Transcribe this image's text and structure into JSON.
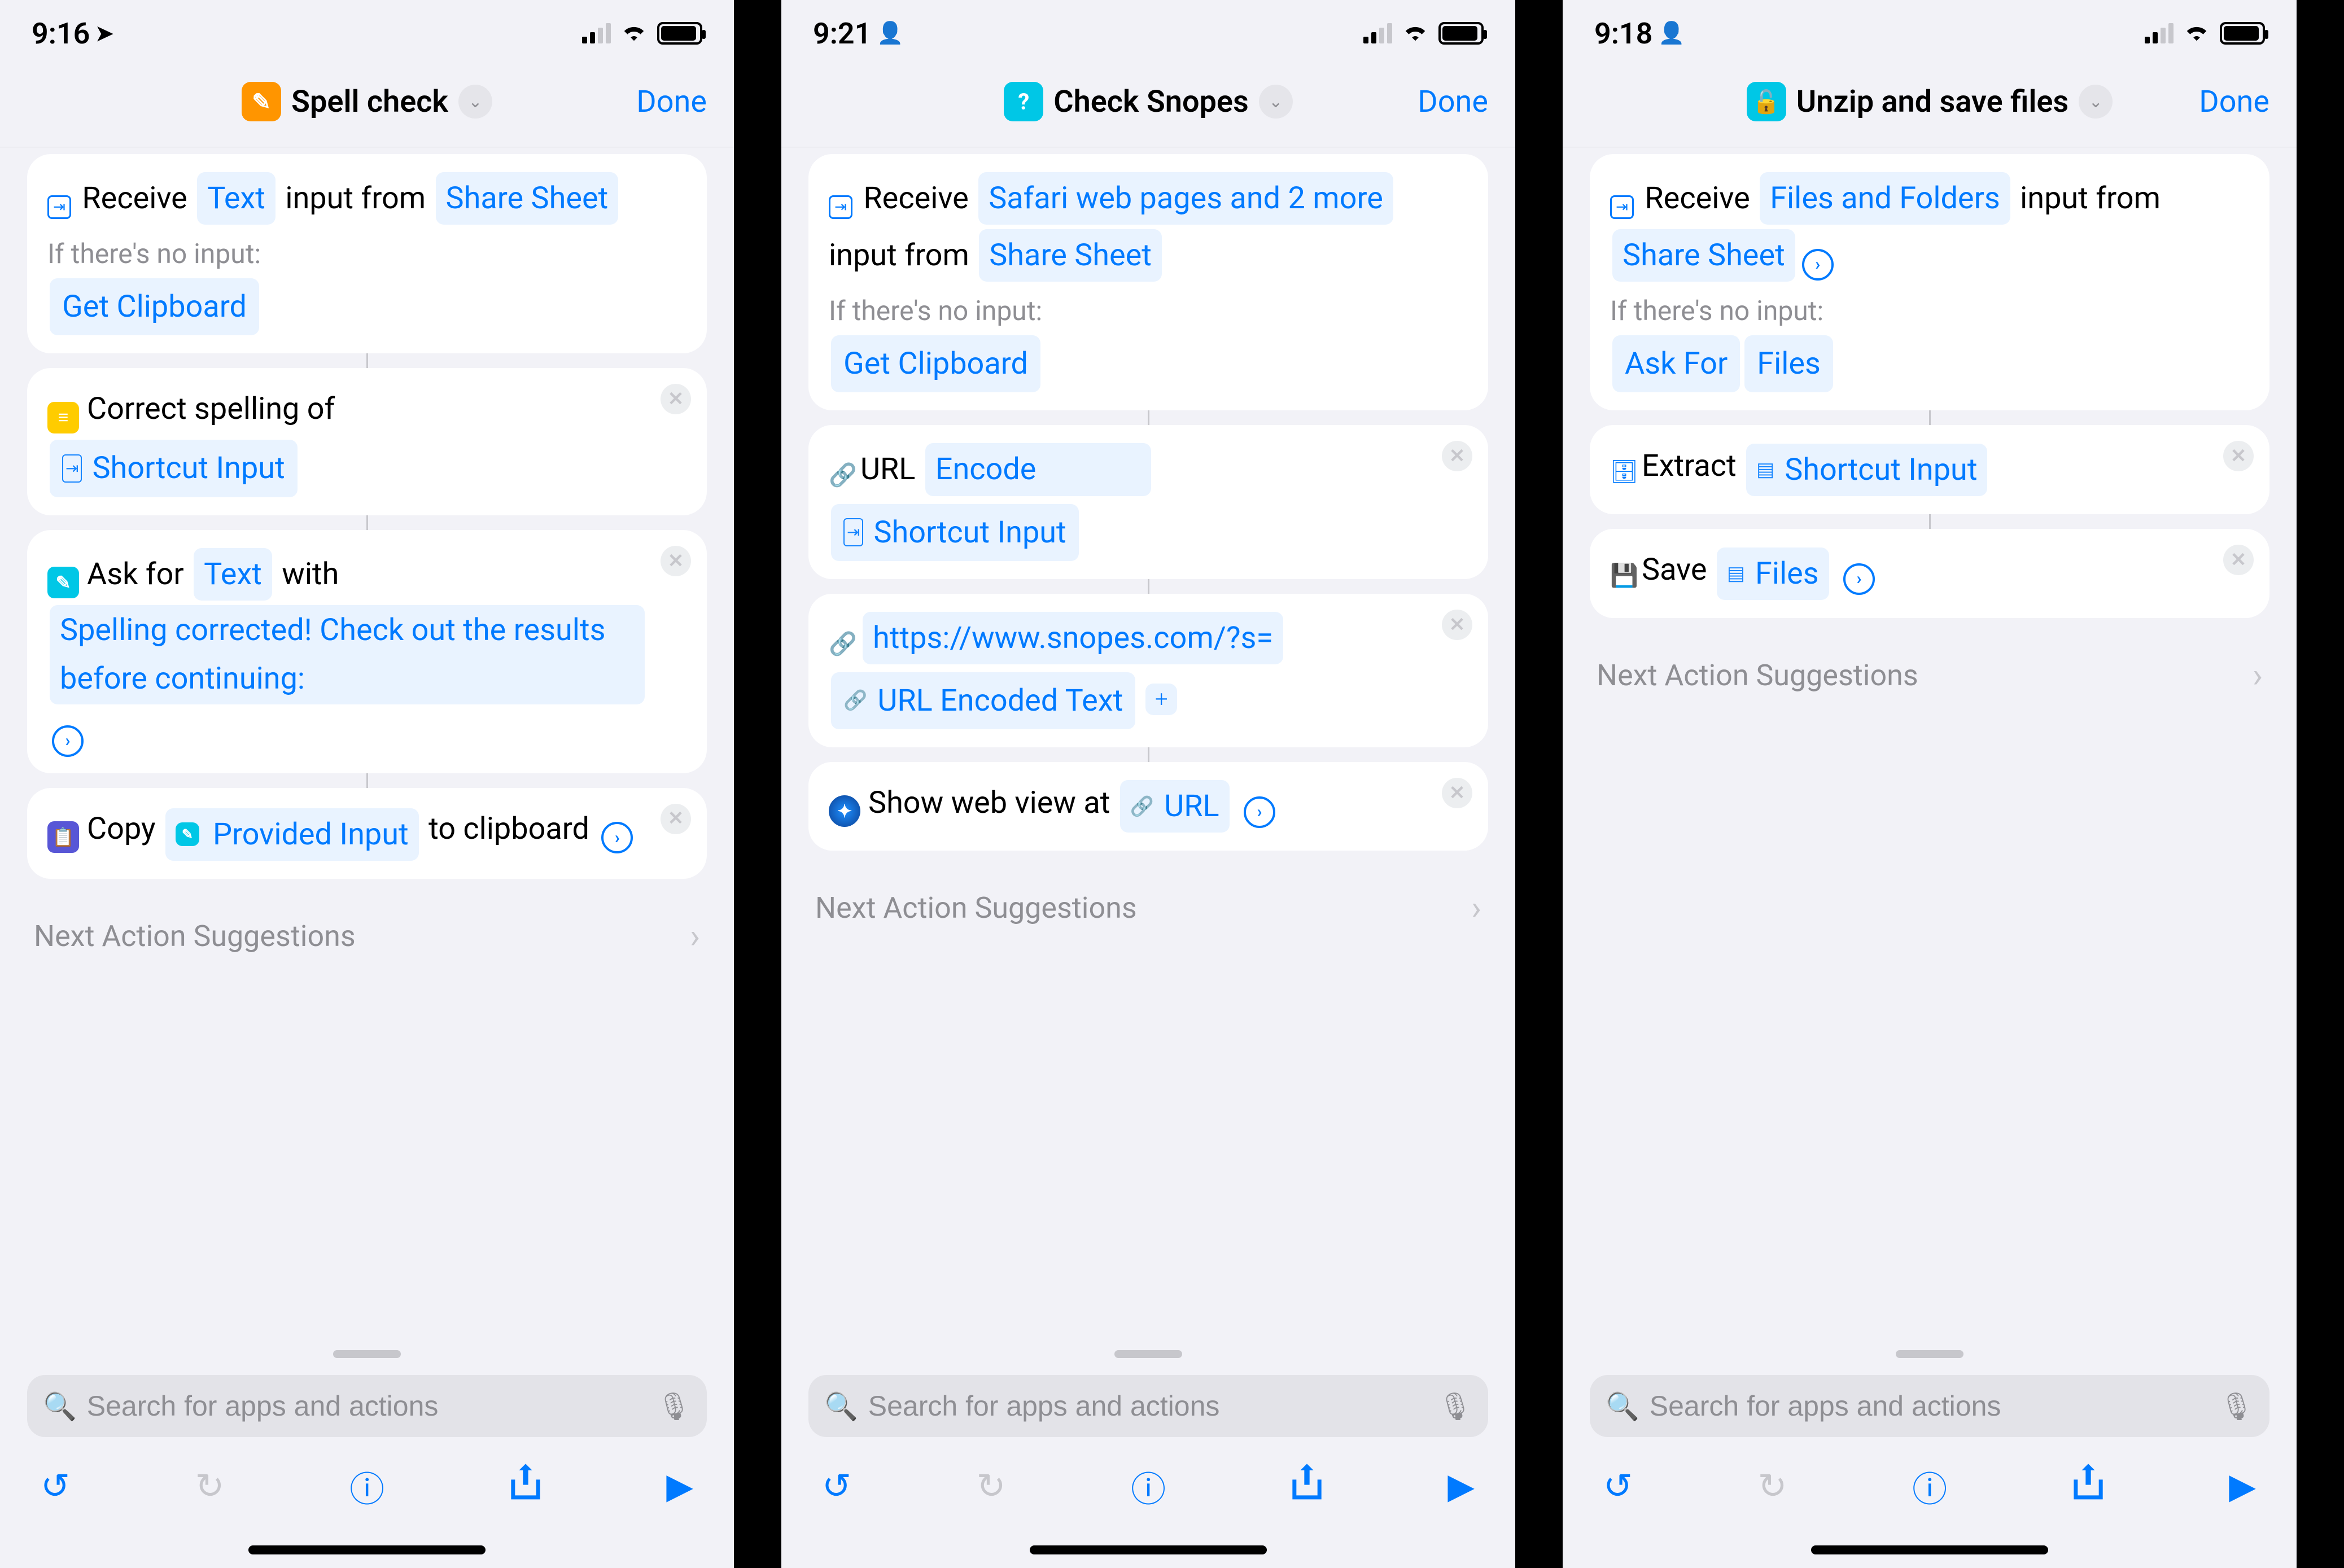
{
  "accent": "#007aff",
  "screens": [
    {
      "status": {
        "time": "9:16",
        "indicator": "location"
      },
      "header": {
        "icon_bg": "#ff9500",
        "title": "Spell check",
        "done": "Done"
      },
      "receive": {
        "prefix": "Receive",
        "types": "Text",
        "mid": "input from",
        "source": "Share Sheet",
        "no_input_label": "If there's no input:",
        "fallback": "Get Clipboard"
      },
      "actions": [
        {
          "icon_bg": "#ffcc00",
          "line1_text": "Correct spelling of",
          "line2_token": "Shortcut Input",
          "line2_token_icon": true
        },
        {
          "icon_bg": "#00c7e6",
          "line1_a": "Ask for",
          "line1_tok": "Text",
          "line1_b": "with",
          "trail_tok": "Spelling corrected! Check out the results before continuing:",
          "trail_chev": true
        },
        {
          "icon_bg": "#5856d6",
          "line1_a": "Copy",
          "inline_tok_icon_bg": "#00c7e6",
          "inline_tok": "Provided Input",
          "line1_b": "to clipboard",
          "trail_chev": true
        }
      ],
      "nas": "Next Action Suggestions",
      "search_placeholder": "Search for apps and actions"
    },
    {
      "status": {
        "time": "9:21",
        "indicator": "person"
      },
      "header": {
        "icon_bg": "#00c7e6",
        "title": "Check Snopes",
        "done": "Done"
      },
      "receive": {
        "prefix": "Receive",
        "types": "Safari web pages and 2 more",
        "mid": "input from",
        "source": "Share Sheet",
        "no_input_label": "If there's no input:",
        "fallback": "Get Clipboard"
      },
      "actions": [
        {
          "plain_icon": "🔗",
          "line1_a": "URL",
          "line1_tok": "Encode",
          "line1_tok_wide": true,
          "line2_token": "Shortcut Input",
          "line2_token_icon": true
        },
        {
          "plain_icon": "🔗",
          "url_tok": "https://www.snopes.com/?s=",
          "line2_token": "URL Encoded Text",
          "line2_token_icon_link": true,
          "add_btn": true
        },
        {
          "safari_icon": true,
          "line1_a": "Show web view at",
          "inline_tok_link": "URL",
          "trail_chev": true
        }
      ],
      "nas": "Next Action Suggestions",
      "search_placeholder": "Search for apps and actions"
    },
    {
      "status": {
        "time": "9:18",
        "indicator": "person"
      },
      "header": {
        "icon_bg": "#00c7e6",
        "title": "Unzip and save files",
        "done": "Done"
      },
      "receive": {
        "prefix": "Receive",
        "types": "Files and Folders",
        "mid": "input from",
        "source": "Share Sheet",
        "source_chev": true,
        "no_input_label": "If there's no input:",
        "fallback": "Ask For",
        "fallback2": "Files"
      },
      "actions": [
        {
          "file_icon": true,
          "line1_a": "Extract",
          "inline_tok_file": "Shortcut Input"
        },
        {
          "save_icon": true,
          "line1_a": "Save",
          "inline_tok_file": "Files",
          "trail_chev": true
        }
      ],
      "nas": "Next Action Suggestions",
      "search_placeholder": "Search for apps and actions"
    }
  ]
}
